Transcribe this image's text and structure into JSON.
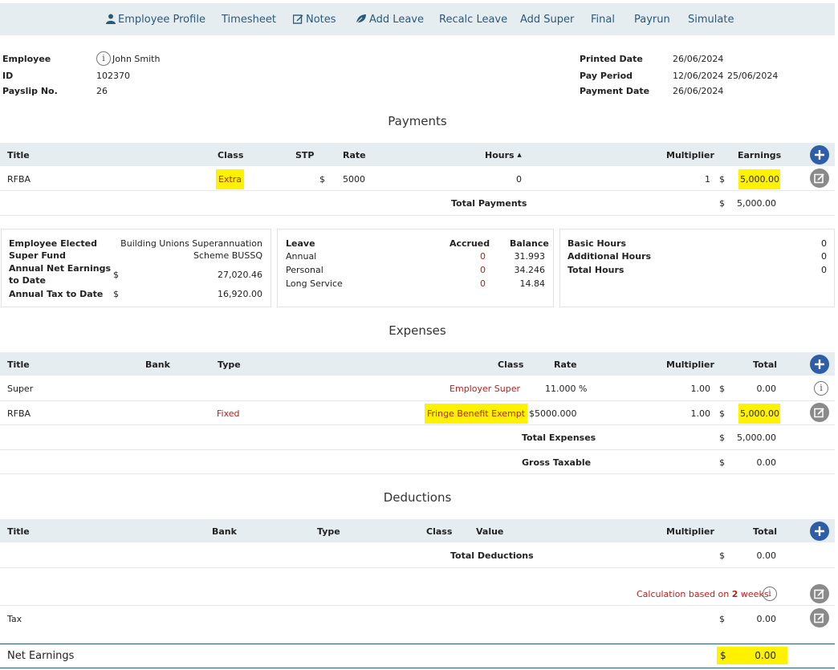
{
  "nav": [
    {
      "label": "Employee Profile",
      "icon": "user-icon"
    },
    {
      "label": "Timesheet"
    },
    {
      "label": "Notes",
      "icon": "edit-icon"
    },
    {
      "label": "Add Leave",
      "icon": "leaf-icon"
    },
    {
      "label": "Recalc Leave"
    },
    {
      "label": "Add Super"
    },
    {
      "label": "Final"
    },
    {
      "label": "Payrun"
    },
    {
      "label": "Simulate"
    }
  ],
  "header": {
    "employee_label": "Employee",
    "employee_value": "John Smith",
    "id_label": "ID",
    "id_value": "102370",
    "payslip_label": "Payslip No.",
    "payslip_value": "26",
    "printed_label": "Printed Date",
    "printed_value": "26/06/2024",
    "period_label": "Pay Period",
    "period_from": "12/06/2024",
    "period_to": "25/06/2024",
    "payment_label": "Payment Date",
    "payment_value": "26/06/2024"
  },
  "payments": {
    "title": "Payments",
    "cols": {
      "title": "Title",
      "class": "Class",
      "stp": "STP",
      "rate": "Rate",
      "hours": "Hours",
      "multiplier": "Multiplier",
      "earnings": "Earnings"
    },
    "row": {
      "title": "RFBA",
      "class": "Extra",
      "currency": "$",
      "rate": "5000",
      "hours": "0",
      "multiplier": "1",
      "earn_currency": "$",
      "earnings": "5,000.00"
    },
    "total_label": "Total Payments",
    "total_currency": "$",
    "total_value": "5,000.00"
  },
  "summary": {
    "super_label": "Employee Elected Super Fund",
    "super_value_1": "Building Unions Superannuation",
    "super_value_2": "Scheme BUSSQ",
    "net_label_1": "Annual Net Earnings",
    "net_label_2": "to Date",
    "net_currency": "$",
    "net_value": "27,020.46",
    "tax_label": "Annual Tax to Date",
    "tax_currency": "$",
    "tax_value": "16,920.00",
    "leave_header": "Leave",
    "accrued_header": "Accrued",
    "balance_header": "Balance",
    "leave_rows": [
      {
        "name": "Annual",
        "accrued": "0",
        "balance": "31.993"
      },
      {
        "name": "Personal",
        "accrued": "0",
        "balance": "34.246"
      },
      {
        "name": "Long Service",
        "accrued": "0",
        "balance": "14.84"
      }
    ],
    "basic_hours_label": "Basic Hours",
    "basic_hours": "0",
    "additional_hours_label": "Additional Hours",
    "additional_hours": "0",
    "total_hours_label": "Total Hours",
    "total_hours": "0"
  },
  "expenses": {
    "title": "Expenses",
    "cols": {
      "title": "Title",
      "bank": "Bank",
      "type": "Type",
      "class": "Class",
      "rate": "Rate",
      "multiplier": "Multiplier",
      "total": "Total"
    },
    "rows": [
      {
        "title": "Super",
        "type": "",
        "class": "Employer Super",
        "rate": "11.000 %",
        "multiplier": "1.00",
        "currency": "$",
        "total": "0.00"
      },
      {
        "title": "RFBA",
        "type": "Fixed",
        "class": "Fringe Benefit Exempt",
        "rate": "$5000.000",
        "multiplier": "1.00",
        "currency": "$",
        "total": "5,000.00"
      }
    ],
    "total_label": "Total Expenses",
    "total_currency": "$",
    "total_value": "5,000.00",
    "gross_label": "Gross Taxable",
    "gross_currency": "$",
    "gross_value": "0.00"
  },
  "deductions": {
    "title": "Deductions",
    "cols": {
      "title": "Title",
      "bank": "Bank",
      "type": "Type",
      "class": "Class",
      "value": "Value",
      "multiplier": "Multiplier",
      "total": "Total"
    },
    "total_label": "Total Deductions",
    "total_currency": "$",
    "total_value": "0.00",
    "calc_prefix": "Calculation based on",
    "calc_weeks": "2",
    "calc_suffix": "weeks",
    "tax_label": "Tax",
    "tax_currency": "$",
    "tax_value": "0.00"
  },
  "net": {
    "label": "Net Earnings",
    "currency": "$",
    "value": "0.00"
  },
  "colors": {
    "accent_blue": "#2f5ea8",
    "highlight": "#fff200",
    "header_bg": "#e6edf1",
    "red_text": "#b22222",
    "edit_grey": "#8a8a8a"
  }
}
